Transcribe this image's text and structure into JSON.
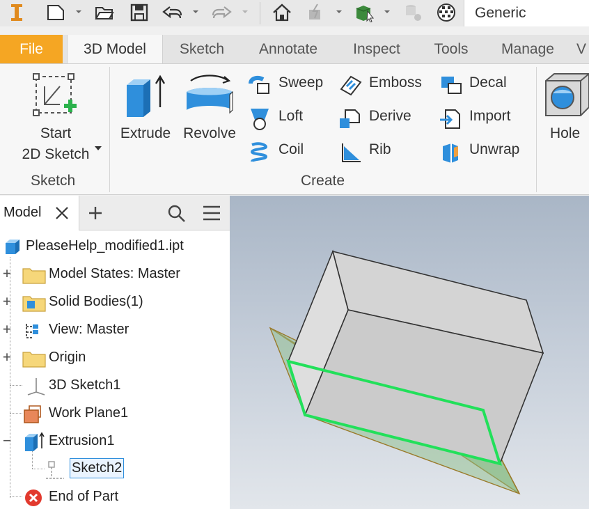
{
  "quick_access": {
    "material": "Generic"
  },
  "tabs": [
    "File",
    "3D Model",
    "Sketch",
    "Annotate",
    "Inspect",
    "Tools",
    "Manage",
    "V"
  ],
  "ribbon": {
    "sketch_panel": {
      "start_line1": "Start",
      "start_line2": "2D Sketch",
      "label": "Sketch"
    },
    "create_panel": {
      "extrude": "Extrude",
      "revolve": "Revolve",
      "sweep": "Sweep",
      "loft": "Loft",
      "coil": "Coil",
      "emboss": "Emboss",
      "derive": "Derive",
      "rib": "Rib",
      "decal": "Decal",
      "import": "Import",
      "unwrap": "Unwrap",
      "label": "Create"
    },
    "hole": "Hole"
  },
  "browser": {
    "tab_label": "Model",
    "tree": [
      {
        "label": "PleaseHelp_modified1.ipt"
      },
      {
        "label": "Model States: Master"
      },
      {
        "label": "Solid Bodies(1)"
      },
      {
        "label": "View: Master"
      },
      {
        "label": "Origin"
      },
      {
        "label": "3D Sketch1"
      },
      {
        "label": "Work Plane1"
      },
      {
        "label": "Extrusion1"
      },
      {
        "label": "Sketch2"
      },
      {
        "label": "End of Part"
      }
    ]
  },
  "colors": {
    "file_tab": "#f5a623",
    "sketch_profile": "#22e05a",
    "work_plane": "#8fbf8c"
  }
}
